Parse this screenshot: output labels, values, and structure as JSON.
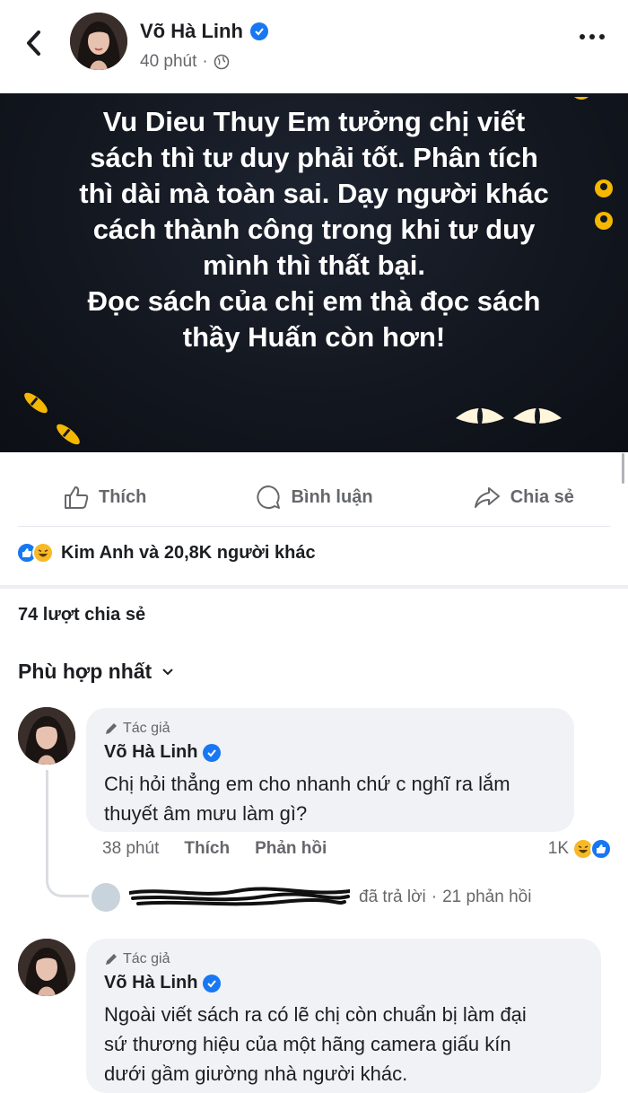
{
  "header": {
    "author": "Võ Hà Linh",
    "time": "40 phút",
    "separator": "·",
    "icons": {
      "back": "back-chevron-icon",
      "verified": "verified-badge-icon",
      "privacy": "globe-icon",
      "more": "more-dots-icon"
    }
  },
  "post": {
    "lines": [
      "Vu Dieu Thuy Em tưởng chị viết",
      "sách thì tư duy phải tốt. Phân tích",
      "thì dài mà toàn sai. Dạy người khác",
      "cách thành công trong khi tư duy",
      "mình thì thất bại.",
      "Đọc sách của chị em thà đọc sách",
      "thầy Huấn còn hơn!"
    ],
    "colors": {
      "background": "#12161e",
      "text": "#ffffff",
      "accent": "#f5b800"
    }
  },
  "actions": {
    "like": "Thích",
    "comment": "Bình luận",
    "share": "Chia sẻ"
  },
  "reactions": {
    "summary": "Kim Anh và 20,8K người khác"
  },
  "shares": "74 lượt chia sẻ",
  "sort": {
    "label": "Phù hợp nhất"
  },
  "comments": [
    {
      "author_tag": "Tác giả",
      "name": "Võ Hà Linh",
      "lines": [
        "Chị hỏi thẳng em cho nhanh chứ c nghĩ ra lắm",
        "thuyết âm mưu làm gì?"
      ],
      "time": "38 phút",
      "like": "Thích",
      "reply": "Phản hồi",
      "reaction_count": "1K",
      "replies": {
        "text": "đã trả lời",
        "separator": "·",
        "count": "21 phản hồi"
      }
    },
    {
      "author_tag": "Tác giả",
      "name": "Võ Hà Linh",
      "lines": [
        "Ngoài viết sách ra có lẽ chị còn chuẩn bị làm đại",
        "sứ thương hiệu của một hãng camera giấu kín",
        "dưới gầm giường nhà người khác."
      ]
    }
  ],
  "colors": {
    "facebook_blue": "#1877f2",
    "muted": "#65676b",
    "bubble": "#f0f2f5"
  }
}
